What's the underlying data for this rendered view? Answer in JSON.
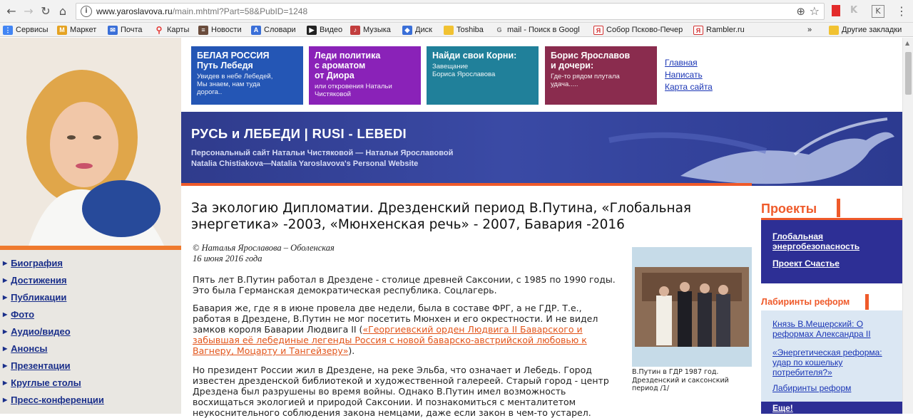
{
  "browser": {
    "url_host": "www.yaroslavova.ru",
    "url_path": "/main.mhtml?Part=58&PubID=1248",
    "bookmarks": [
      {
        "label": "Сервисы",
        "color": "#4285f4"
      },
      {
        "label": "Маркет",
        "color": "#e5a322"
      },
      {
        "label": "Почта",
        "color": "#3a6fd8"
      },
      {
        "label": "Карты",
        "color": "#e53935"
      },
      {
        "label": "Новости",
        "color": "#6a4c3c"
      },
      {
        "label": "Словари",
        "color": "#3a6fd8"
      },
      {
        "label": "Видео",
        "color": "#222222"
      },
      {
        "label": "Музыка",
        "color": "#c23d3d"
      },
      {
        "label": "Диск",
        "color": "#3a6fd8"
      },
      {
        "label": "Toshiba",
        "color": "#f1c232"
      },
      {
        "label": "mail - Поиск в Googl",
        "color": "#777777"
      },
      {
        "label": "Собор Псково-Печер",
        "color": "#d33131"
      },
      {
        "label": "Rambler.ru",
        "color": "#d33131"
      },
      {
        "label": "»",
        "color": ""
      },
      {
        "label": "Другие закладки",
        "color": "#f1c232"
      }
    ]
  },
  "left_nav": {
    "items": [
      "Биография",
      "Достижения",
      "Публикации",
      "Фото",
      "Аудио/видео",
      "Анонсы",
      "Презентации",
      "Круглые столы",
      "Пресс-конференции"
    ]
  },
  "top_tiles": [
    {
      "title": "БЕЛАЯ РОССИЯ\nПуть Лебедя",
      "text": "Увидев в небе Лебедей,\nМы знаем, нам туда\nдорога..",
      "color": "#2456b5"
    },
    {
      "title": "Леди политика\nс ароматом\nот Диора",
      "text": "или откровения Натальи\nЧистяковой",
      "color": "#8a22b8"
    },
    {
      "title": "Найди свои Корни:",
      "text": "Завещание\nБориса Ярославова",
      "color": "#20809a"
    },
    {
      "title": "Борис Ярославов\nи дочери:",
      "text": "Где-то рядом плутала\nудача.....",
      "color": "#8a2c4e"
    }
  ],
  "top_links": [
    "Главная",
    "Написать",
    "Карта сайта"
  ],
  "hero": {
    "title": "РУСЬ и ЛЕБЕДИ | RUSI - LEBEDI",
    "subtitle1": "Персональный сайт Натальи Чистяковой — Натальи Ярославовой",
    "subtitle2": "Natalia Chistiakova—Natalia Yaroslavova's Personal Website"
  },
  "article": {
    "headline": "За экологию Дипломатии. Дрезденский период В.Путина, «Глобальная энергетика» -2003, «Мюнхенская речь» - 2007, Бавария -2016",
    "author": "© Наталья Ярославова – Оболенская",
    "date": "16 июня 2016 года",
    "p1": "Пять лет В.Путин работал в Дрездене - столице древней Саксонии, с 1985 по 1990 годы. Это была Германская демократическая республика. Соцлагерь.",
    "p2_before": "Бавария же, где я в июне провела две недели, была в составе ФРГ, а не ГДР. Т.е., работая в Дрездене, В.Путин не мог посетить Мюнхен и его окрестности. И не видел замков короля Баварии Людвига II (",
    "p2_link": "«Георгиевский орден Людвига II Баварского и забывшая её лебединые легенды Россия с новой баварско-австрийской любовью к Вагнеру, Моцарту и Тангейзеру»",
    "p2_after": ").",
    "p3": "Но президент России жил в Дрездене, на реке Эльба, что означает и Лебедь. Город известен дрезденской библиотекой и художественной галереей. Старый город - центр Дрездена был разрушены во время войны. Однако В.Путин имел возможность восхищаться экологией и природой Саксонии. И познакомиться с менталитетом неукоснительного соблюдения закона немцами, даже если закон в чем-то устарел.",
    "figure_caption": "В.Путин в ГДР 1987 год. Дрезденский и саксонский период /1/"
  },
  "right": {
    "projects_title": "Проекты",
    "projects": [
      "Глобальная энергобезопасность",
      "Проект Счастье"
    ],
    "labyrinths_title": "Лабиринты реформ",
    "labyrinths": [
      "Князь В.Мещерский: О реформах Александра II",
      "«Энергетическая реформа: удар по кошельку потребителя?»",
      "Лабиринты реформ"
    ],
    "more": "Еще!"
  }
}
